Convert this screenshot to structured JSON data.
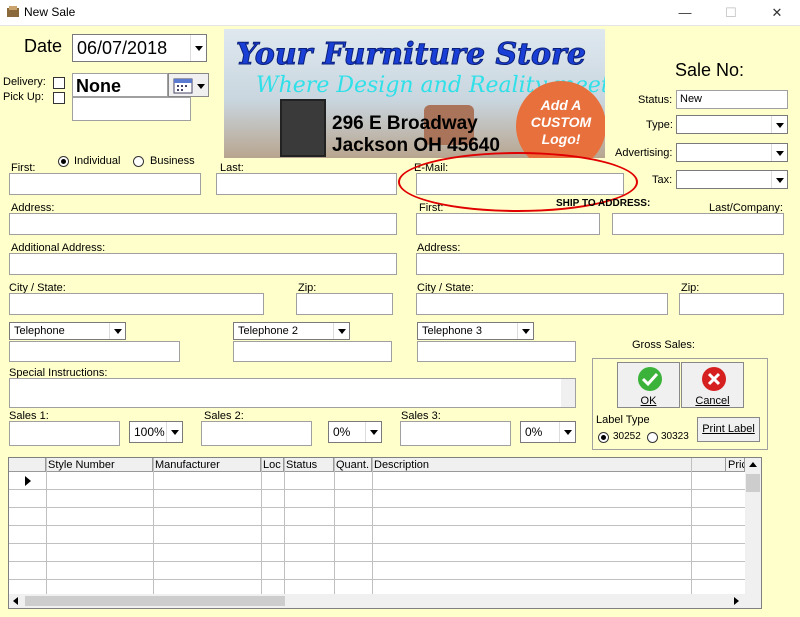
{
  "window": {
    "title": "New Sale",
    "minimize": "—",
    "maximize": "☐",
    "close": "✕"
  },
  "header": {
    "date_label": "Date",
    "date_value": "06/07/2018",
    "delivery_label": "Delivery:",
    "pickup_label": "Pick Up:",
    "driver_value": "None",
    "sale_no_label": "Sale No:"
  },
  "banner": {
    "store_name": "Your Furniture Store",
    "tagline": "Where Design and Reality meet!!",
    "address_line1": "296 E Broadway",
    "address_line2": "Jackson OH 45640",
    "logo_line1": "Add A",
    "logo_line2": "CUSTOM",
    "logo_line3": "Logo!"
  },
  "sale_info": {
    "status_label": "Status:",
    "status_value": "New",
    "type_label": "Type:",
    "advertising_label": "Advertising:",
    "tax_label": "Tax:"
  },
  "customer": {
    "individual_label": "Individual",
    "business_label": "Business",
    "first_label": "First:",
    "last_label": "Last:",
    "email_label": "E-Mail:",
    "address_label": "Address:",
    "additional_address_label": "Additional Address:",
    "city_state_label": "City / State:",
    "zip_label": "Zip:",
    "phone1": "Telephone",
    "phone2": "Telephone 2",
    "phone3": "Telephone 3",
    "special_instructions_label": "Special Instructions:"
  },
  "ship_to": {
    "heading": "SHIP TO ADDRESS:",
    "first_label": "First:",
    "last_company_label": "Last/Company:",
    "address_label": "Address:",
    "city_state_label": "City / State:",
    "zip_label": "Zip:"
  },
  "sales": {
    "sales1_label": "Sales 1:",
    "sales1_pct": "100%",
    "sales2_label": "Sales 2:",
    "sales2_pct": "0%",
    "sales3_label": "Sales 3:",
    "sales3_pct": "0%"
  },
  "gross": {
    "label": "Gross Sales:",
    "ok_label": "OK",
    "cancel_label": "Cancel",
    "label_type": "Label Type",
    "opt1": "30252",
    "opt2": "30323",
    "print_label": "Print Label"
  },
  "grid": {
    "columns": [
      "Style Number",
      "Manufacturer",
      "Loc",
      "Status",
      "Quant.",
      "Description",
      "Pric"
    ],
    "row_count": 7
  },
  "colors": {
    "background": "#ffffcc",
    "ok_green": "#3bb33b",
    "cancel_red": "#d62020",
    "annotation": "#e00000"
  }
}
